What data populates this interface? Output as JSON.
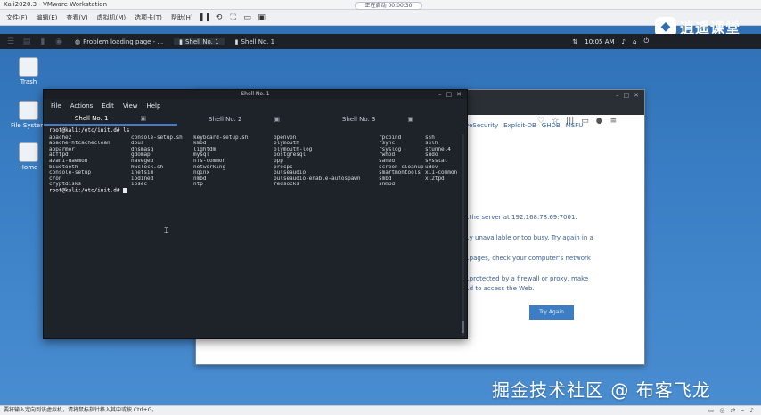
{
  "vmware": {
    "title": "Kali2020.3 - VMware Workstation",
    "menu": [
      "文件(F)",
      "编辑(E)",
      "查看(V)",
      "虚拟机(M)",
      "选项卡(T)",
      "帮助(H)"
    ],
    "pill": "正在启动 00:00:30"
  },
  "brand": {
    "logo": "◆",
    "name": "逍遥课堂"
  },
  "kali_panel": {
    "tasks": [
      {
        "label": "Problem loading page - ..."
      },
      {
        "label": "Shell No. 1"
      },
      {
        "label": "Shell No. 1"
      }
    ],
    "clock": "10:05 AM"
  },
  "desktop": [
    {
      "label": "Trash"
    },
    {
      "label": "File System"
    },
    {
      "label": "Home"
    }
  ],
  "browser": {
    "bookmarks": [
      "iveSecurity",
      "Exploit-DB",
      "GHDB",
      "MSFU"
    ],
    "lines": [
      "...the server at 192.168.78.69:7001.",
      "...y unavailable or too busy. Try again in a",
      "...pages, check your computer's network",
      "...protected by a firewall or proxy, make",
      "...d to access the Web."
    ],
    "try_again": "Try Again"
  },
  "terminal": {
    "title": "Shell No. 1",
    "menu": [
      "File",
      "Actions",
      "Edit",
      "View",
      "Help"
    ],
    "tabs": [
      "Shell No. 1",
      "Shell No. 2",
      "Shell No. 3"
    ],
    "prompt": "root@kali:/etc/init.d# ls",
    "prompt2": "root@kali:/etc/init.d# ",
    "ls": [
      [
        "apache2",
        "console-setup.sh",
        "keyboard-setup.sh",
        "openvpn",
        "rpcbind",
        "ssh"
      ],
      [
        "apache-htcacheclean",
        "dbus",
        "kmod",
        "plymouth",
        "rsync",
        "sslh"
      ],
      [
        "apparmor",
        "dnsmasq",
        "lightdm",
        "plymouth-log",
        "rsyslog",
        "stunnel4"
      ],
      [
        "atftpd",
        "gdomap",
        "mysql",
        "postgresql",
        "rwhod",
        "sudo"
      ],
      [
        "avahi-daemon",
        "haveged",
        "nfs-common",
        "ppp",
        "saned",
        "sysstat"
      ],
      [
        "bluetooth",
        "hwclock.sh",
        "networking",
        "procps",
        "screen-cleanup",
        "udev"
      ],
      [
        "console-setup",
        "inetsim",
        "nginx",
        "pulseaudio",
        "smartmontools",
        "x11-common"
      ],
      [
        "cron",
        "iodined",
        "nmbd",
        "pulseaudio-enable-autospawn",
        "smbd",
        "xl2tpd"
      ],
      [
        "cryptdisks",
        "ipsec",
        "ntp",
        "redsocks",
        "snmpd",
        ""
      ]
    ]
  },
  "watermark": "掘金技术社区 @ 布客飞龙",
  "status": "要将输入定向到该虚拟机，请将鼠标指针移入其中或按 Ctrl+G。"
}
